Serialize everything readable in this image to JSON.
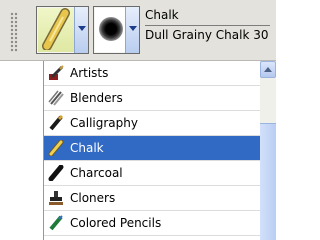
{
  "toolbar": {
    "brush_category_icon": "chalk-stick-icon",
    "brush_variant_icon": "round-grainy-dab-icon",
    "category_name": "Chalk",
    "variant_name": "Dull Grainy Chalk 30"
  },
  "list": {
    "selected_index": 3,
    "items": [
      {
        "label": "Artists",
        "icon": "artists-brush-icon"
      },
      {
        "label": "Blenders",
        "icon": "blenders-icon"
      },
      {
        "label": "Calligraphy",
        "icon": "calligraphy-pen-icon"
      },
      {
        "label": "Chalk",
        "icon": "chalk-stick-icon"
      },
      {
        "label": "Charcoal",
        "icon": "charcoal-stick-icon"
      },
      {
        "label": "Cloners",
        "icon": "cloners-stamp-icon"
      },
      {
        "label": "Colored Pencils",
        "icon": "colored-pencil-icon"
      }
    ]
  },
  "colors": {
    "selection": "#316ac5",
    "toolbar_bg": "#e3e2dc"
  }
}
